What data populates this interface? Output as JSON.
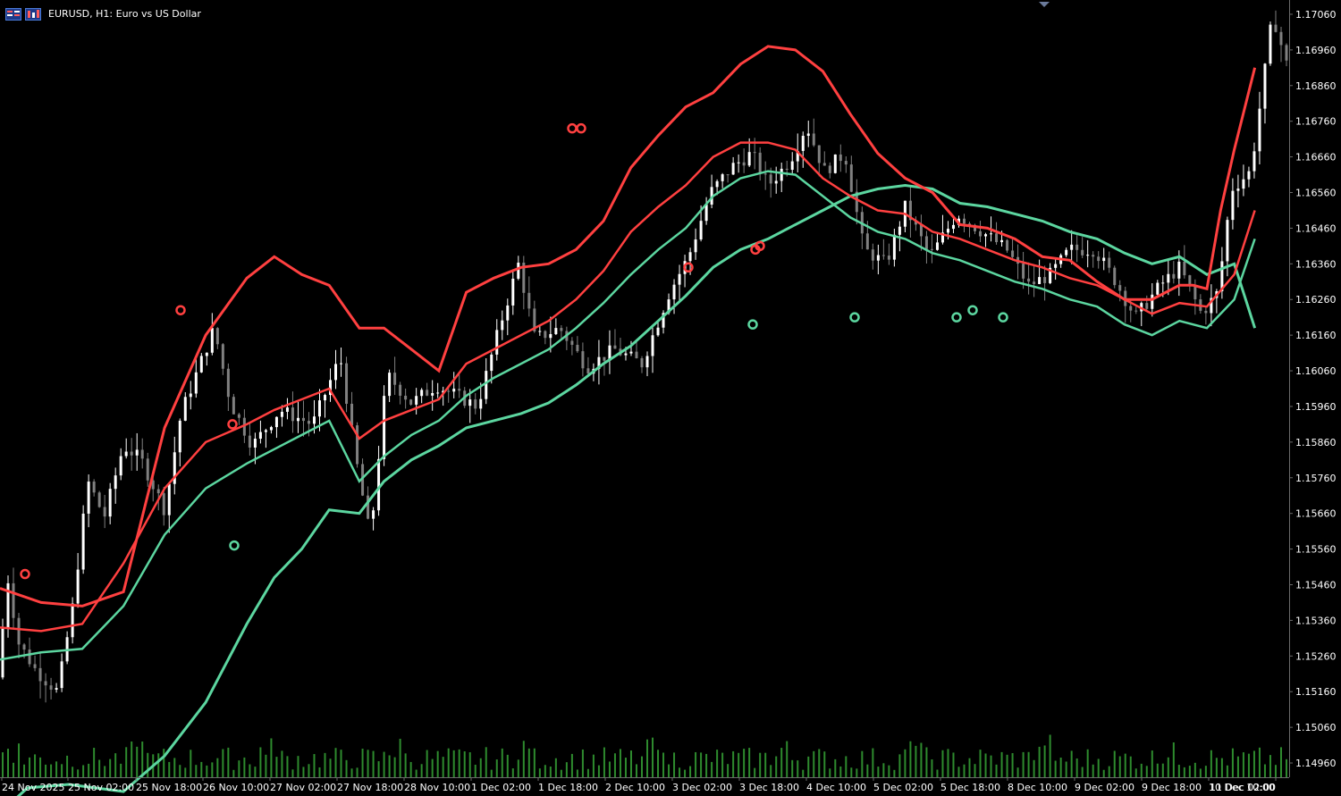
{
  "window": {
    "title": "EURUSD, H1:  Euro vs US Dollar",
    "icons": [
      "market-watch-icon",
      "chart-type-icon"
    ]
  },
  "colors": {
    "background": "#000000",
    "text": "#ffffff",
    "bull_candle": "#ffffff",
    "bear_candle": "#808080",
    "upper_band": "#ff4040",
    "middle_band": "#ff4040",
    "lower_band": "#5cd6a0",
    "mid_lower_band": "#5cd6a0",
    "volume": "#2e8b2e",
    "sell_marker": "#ff4040",
    "buy_marker": "#5cd6a0",
    "frame": "#6a6a6a"
  },
  "chart_data": {
    "type": "candlestick",
    "symbol": "EURUSD",
    "timeframe": "H1",
    "title": "EURUSD, H1:  Euro vs US Dollar",
    "y_ticks": [
      "1.17060",
      "1.16960",
      "1.16860",
      "1.16760",
      "1.16660",
      "1.16560",
      "1.16460",
      "1.16360",
      "1.16260",
      "1.16160",
      "1.16060",
      "1.15960",
      "1.15860",
      "1.15760",
      "1.15660",
      "1.15560",
      "1.15460",
      "1.15360",
      "1.15260",
      "1.15160",
      "1.15060",
      "1.14960"
    ],
    "x_ticks": [
      "24 Nov 2025",
      "25 Nov 02:00",
      "25 Nov 18:00",
      "26 Nov 10:00",
      "27 Nov 02:00",
      "27 Nov 18:00",
      "28 Nov 10:00",
      "1 Dec 02:00",
      "1 Dec 18:00",
      "2 Dec 10:00",
      "3 Dec 02:00",
      "3 Dec 18:00",
      "4 Dec 10:00",
      "5 Dec 02:00",
      "5 Dec 18:00",
      "8 Dec 10:00",
      "9 Dec 02:00",
      "9 Dec 18:00",
      "10 Dec 10:00",
      "11 Dec 02:00"
    ],
    "ylim": [
      1.1492,
      1.171
    ],
    "bars": 240,
    "price_path": [
      [
        0,
        1.152
      ],
      [
        8,
        1.1548
      ],
      [
        15,
        1.153
      ],
      [
        28,
        1.1522
      ],
      [
        44,
        1.1516
      ],
      [
        55,
        1.154
      ],
      [
        66,
        1.1575
      ],
      [
        78,
        1.1565
      ],
      [
        92,
        1.1585
      ],
      [
        105,
        1.1581
      ],
      [
        122,
        1.1567
      ],
      [
        134,
        1.1594
      ],
      [
        158,
        1.1618
      ],
      [
        170,
        1.1597
      ],
      [
        186,
        1.1585
      ],
      [
        206,
        1.1595
      ],
      [
        230,
        1.1591
      ],
      [
        250,
        1.161
      ],
      [
        262,
        1.158
      ],
      [
        272,
        1.1559
      ],
      [
        284,
        1.1605
      ],
      [
        302,
        1.1597
      ],
      [
        320,
        1.1602
      ],
      [
        350,
        1.1596
      ],
      [
        366,
        1.1618
      ],
      [
        380,
        1.1636
      ],
      [
        392,
        1.1615
      ],
      [
        410,
        1.1618
      ],
      [
        430,
        1.1607
      ],
      [
        450,
        1.1612
      ],
      [
        470,
        1.1608
      ],
      [
        490,
        1.1628
      ],
      [
        504,
        1.1638
      ],
      [
        520,
        1.1656
      ],
      [
        535,
        1.1663
      ],
      [
        550,
        1.1667
      ],
      [
        562,
        1.1658
      ],
      [
        578,
        1.1665
      ],
      [
        590,
        1.1675
      ],
      [
        603,
        1.1662
      ],
      [
        618,
        1.1667
      ],
      [
        632,
        1.164
      ],
      [
        648,
        1.1636
      ],
      [
        662,
        1.1652
      ],
      [
        680,
        1.1638
      ],
      [
        700,
        1.165
      ],
      [
        718,
        1.1645
      ],
      [
        736,
        1.164
      ],
      [
        752,
        1.163
      ],
      [
        768,
        1.1633
      ],
      [
        782,
        1.164
      ],
      [
        800,
        1.164
      ],
      [
        814,
        1.1632
      ],
      [
        830,
        1.1621
      ],
      [
        848,
        1.163
      ],
      [
        862,
        1.1635
      ],
      [
        878,
        1.1622
      ],
      [
        890,
        1.1628
      ],
      [
        900,
        1.1657
      ],
      [
        914,
        1.1662
      ],
      [
        930,
        1.1706
      ],
      [
        940,
        1.1692
      ]
    ],
    "upper_band": [
      [
        0,
        1.1545
      ],
      [
        30,
        1.1541
      ],
      [
        60,
        1.154
      ],
      [
        90,
        1.1544
      ],
      [
        120,
        1.159
      ],
      [
        150,
        1.1616
      ],
      [
        180,
        1.1632
      ],
      [
        200,
        1.1638
      ],
      [
        220,
        1.1633
      ],
      [
        240,
        1.163
      ],
      [
        262,
        1.1618
      ],
      [
        280,
        1.1618
      ],
      [
        300,
        1.1612
      ],
      [
        320,
        1.1606
      ],
      [
        340,
        1.1628
      ],
      [
        360,
        1.1632
      ],
      [
        380,
        1.1635
      ],
      [
        400,
        1.1636
      ],
      [
        420,
        1.164
      ],
      [
        440,
        1.1648
      ],
      [
        460,
        1.1663
      ],
      [
        480,
        1.1672
      ],
      [
        500,
        1.168
      ],
      [
        520,
        1.1684
      ],
      [
        540,
        1.1692
      ],
      [
        560,
        1.1697
      ],
      [
        580,
        1.1696
      ],
      [
        600,
        1.169
      ],
      [
        620,
        1.1678
      ],
      [
        640,
        1.1667
      ],
      [
        660,
        1.166
      ],
      [
        680,
        1.1656
      ],
      [
        700,
        1.1647
      ],
      [
        720,
        1.1646
      ],
      [
        740,
        1.1643
      ],
      [
        760,
        1.1638
      ],
      [
        780,
        1.1637
      ],
      [
        800,
        1.1631
      ],
      [
        820,
        1.1626
      ],
      [
        840,
        1.1626
      ],
      [
        860,
        1.163
      ],
      [
        870,
        1.163
      ],
      [
        880,
        1.1629
      ],
      [
        890,
        1.1651
      ],
      [
        900,
        1.1668
      ],
      [
        915,
        1.1691
      ]
    ],
    "middle_band": [
      [
        0,
        1.1534
      ],
      [
        30,
        1.1533
      ],
      [
        60,
        1.1535
      ],
      [
        90,
        1.1552
      ],
      [
        120,
        1.1573
      ],
      [
        150,
        1.1586
      ],
      [
        180,
        1.1591
      ],
      [
        200,
        1.1595
      ],
      [
        220,
        1.1598
      ],
      [
        240,
        1.1601
      ],
      [
        262,
        1.1587
      ],
      [
        280,
        1.1592
      ],
      [
        300,
        1.1595
      ],
      [
        320,
        1.1598
      ],
      [
        340,
        1.1608
      ],
      [
        360,
        1.1612
      ],
      [
        380,
        1.1616
      ],
      [
        400,
        1.162
      ],
      [
        420,
        1.1626
      ],
      [
        440,
        1.1634
      ],
      [
        460,
        1.1645
      ],
      [
        480,
        1.1652
      ],
      [
        500,
        1.1658
      ],
      [
        520,
        1.1666
      ],
      [
        540,
        1.167
      ],
      [
        560,
        1.167
      ],
      [
        580,
        1.1668
      ],
      [
        600,
        1.166
      ],
      [
        620,
        1.1655
      ],
      [
        640,
        1.1651
      ],
      [
        660,
        1.165
      ],
      [
        680,
        1.1645
      ],
      [
        700,
        1.1643
      ],
      [
        720,
        1.164
      ],
      [
        740,
        1.1637
      ],
      [
        760,
        1.1635
      ],
      [
        780,
        1.1632
      ],
      [
        800,
        1.163
      ],
      [
        820,
        1.1626
      ],
      [
        840,
        1.1622
      ],
      [
        860,
        1.1625
      ],
      [
        880,
        1.1624
      ],
      [
        900,
        1.1633
      ],
      [
        915,
        1.1651
      ]
    ],
    "lower_band": [
      [
        0,
        1.1482
      ],
      [
        20,
        1.1489
      ],
      [
        50,
        1.149
      ],
      [
        90,
        1.1488
      ],
      [
        120,
        1.1498
      ],
      [
        150,
        1.1513
      ],
      [
        180,
        1.1535
      ],
      [
        200,
        1.1548
      ],
      [
        220,
        1.1556
      ],
      [
        240,
        1.1567
      ],
      [
        262,
        1.1566
      ],
      [
        280,
        1.1575
      ],
      [
        300,
        1.1581
      ],
      [
        320,
        1.1585
      ],
      [
        340,
        1.159
      ],
      [
        360,
        1.1592
      ],
      [
        380,
        1.1594
      ],
      [
        400,
        1.1597
      ],
      [
        420,
        1.1602
      ],
      [
        440,
        1.1608
      ],
      [
        460,
        1.1613
      ],
      [
        480,
        1.162
      ],
      [
        500,
        1.1627
      ],
      [
        520,
        1.1635
      ],
      [
        540,
        1.164
      ],
      [
        560,
        1.1643
      ],
      [
        580,
        1.1647
      ],
      [
        600,
        1.1651
      ],
      [
        620,
        1.1655
      ],
      [
        640,
        1.1657
      ],
      [
        660,
        1.1658
      ],
      [
        680,
        1.1657
      ],
      [
        700,
        1.1653
      ],
      [
        720,
        1.1652
      ],
      [
        740,
        1.165
      ],
      [
        760,
        1.1648
      ],
      [
        780,
        1.1645
      ],
      [
        800,
        1.1643
      ],
      [
        820,
        1.1639
      ],
      [
        840,
        1.1636
      ],
      [
        860,
        1.1638
      ],
      [
        880,
        1.1633
      ],
      [
        900,
        1.1636
      ],
      [
        915,
        1.1618
      ]
    ],
    "mid_lower_band": [
      [
        0,
        1.1525
      ],
      [
        30,
        1.1527
      ],
      [
        60,
        1.1528
      ],
      [
        90,
        1.154
      ],
      [
        120,
        1.156
      ],
      [
        150,
        1.1573
      ],
      [
        180,
        1.158
      ],
      [
        200,
        1.1584
      ],
      [
        220,
        1.1588
      ],
      [
        240,
        1.1592
      ],
      [
        262,
        1.1575
      ],
      [
        280,
        1.1582
      ],
      [
        300,
        1.1588
      ],
      [
        320,
        1.1592
      ],
      [
        340,
        1.1599
      ],
      [
        360,
        1.1604
      ],
      [
        380,
        1.1608
      ],
      [
        400,
        1.1612
      ],
      [
        420,
        1.1618
      ],
      [
        440,
        1.1625
      ],
      [
        460,
        1.1633
      ],
      [
        480,
        1.164
      ],
      [
        500,
        1.1646
      ],
      [
        520,
        1.1655
      ],
      [
        540,
        1.166
      ],
      [
        560,
        1.1662
      ],
      [
        580,
        1.1661
      ],
      [
        600,
        1.1655
      ],
      [
        620,
        1.1649
      ],
      [
        640,
        1.1645
      ],
      [
        660,
        1.1643
      ],
      [
        680,
        1.1639
      ],
      [
        700,
        1.1637
      ],
      [
        720,
        1.1634
      ],
      [
        740,
        1.1631
      ],
      [
        760,
        1.1629
      ],
      [
        780,
        1.1626
      ],
      [
        800,
        1.1624
      ],
      [
        820,
        1.1619
      ],
      [
        840,
        1.1616
      ],
      [
        860,
        1.162
      ],
      [
        880,
        1.1618
      ],
      [
        900,
        1.1626
      ],
      [
        915,
        1.1643
      ]
    ],
    "sell_signals": [
      [
        28,
        1.1549
      ],
      [
        260,
        1.1591
      ],
      [
        202,
        1.1623
      ],
      [
        640,
        1.1674
      ],
      [
        650,
        1.1674
      ],
      [
        770,
        1.1635
      ],
      [
        845,
        1.164
      ],
      [
        850,
        1.1641
      ]
    ],
    "buy_signals": [
      [
        262,
        1.1557
      ],
      [
        842,
        1.1619
      ],
      [
        956,
        1.1621
      ],
      [
        1070,
        1.1621
      ],
      [
        1088,
        1.1623
      ],
      [
        1122,
        1.1621
      ]
    ]
  }
}
